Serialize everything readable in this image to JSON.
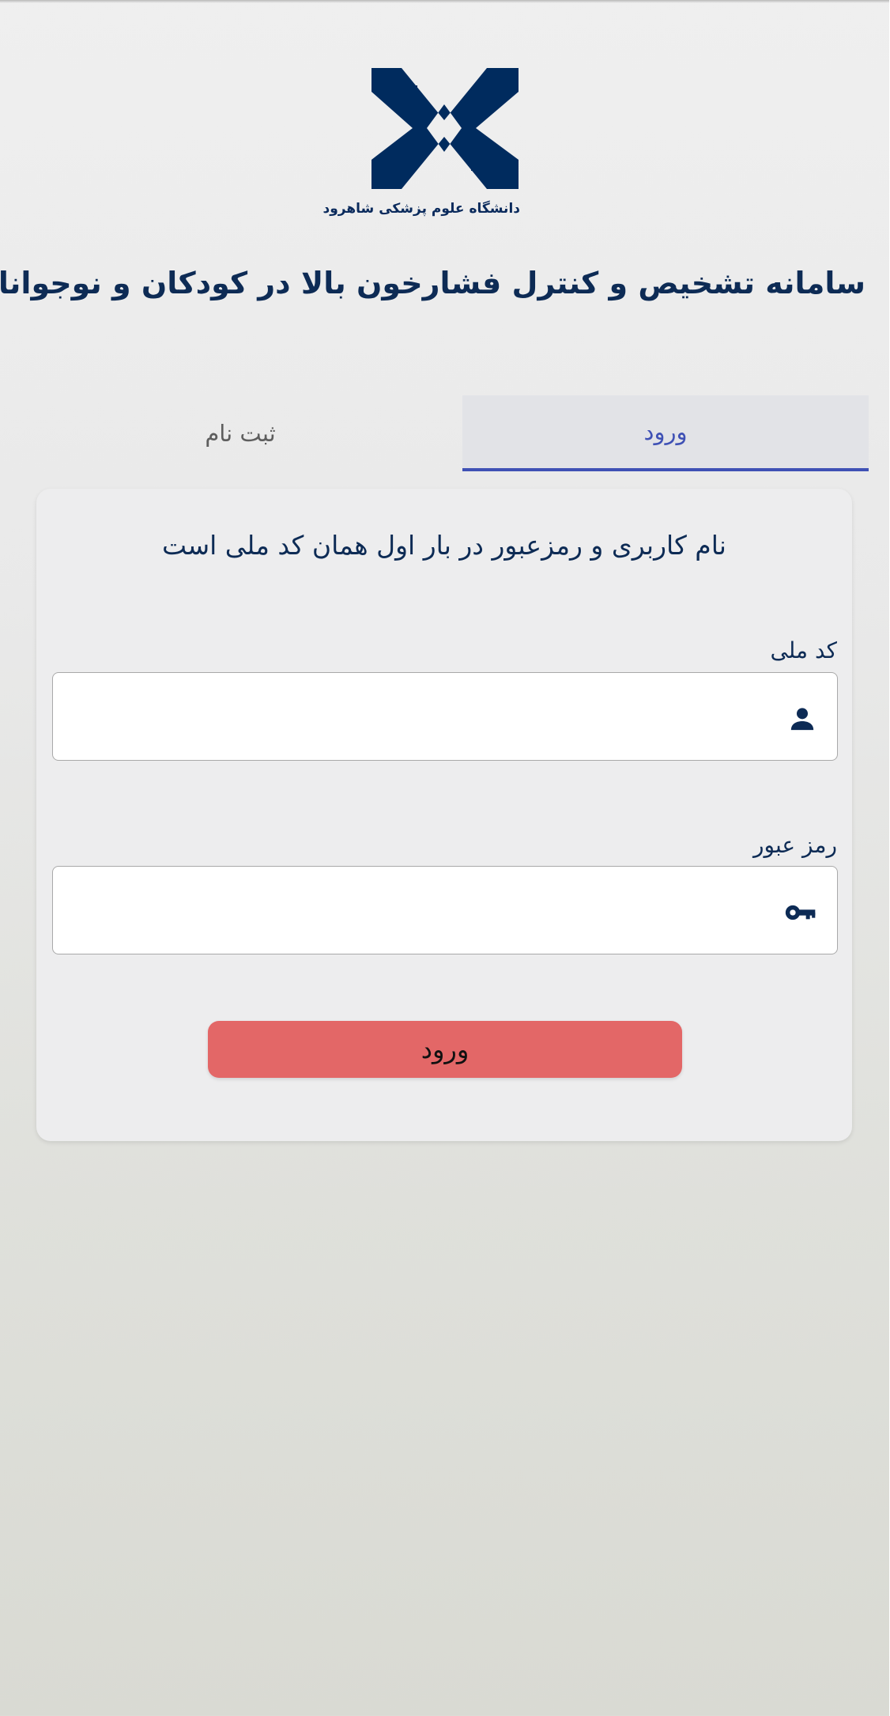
{
  "logo": {
    "caption": "دانشگاه علوم پزشکی شاهرود",
    "color": "#002b5e"
  },
  "header": {
    "title": "سامانه تشخیص و کنترل فشارخون بالا در کودکان و نوجوانان"
  },
  "tabs": [
    {
      "label": "ورود",
      "active": true
    },
    {
      "label": "ثبت نام",
      "active": false
    }
  ],
  "form": {
    "note": "نام کاربری و رمزعبور در بار اول همان کد ملی است",
    "national_id": {
      "label": "کد ملی",
      "value": "",
      "icon": "person-icon"
    },
    "password": {
      "label": "رمز عبور",
      "value": "",
      "icon": "key-icon"
    },
    "submit_label": "ورود"
  },
  "colors": {
    "primary_text": "#0d2b55",
    "accent_tab": "#3f51b5",
    "button": "#e36767"
  }
}
